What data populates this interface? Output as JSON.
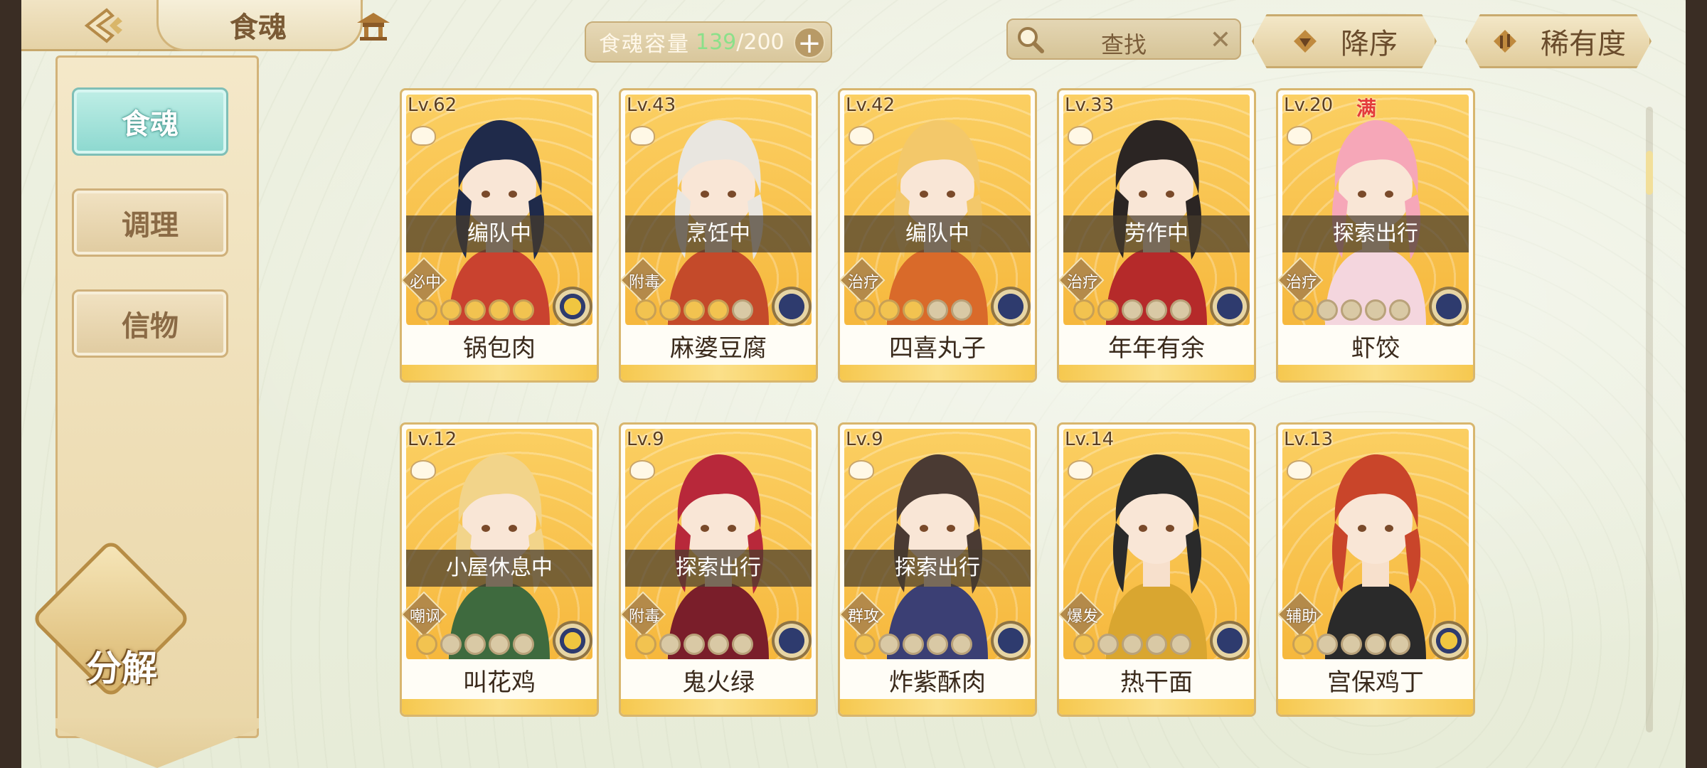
{
  "header": {
    "title": "食魂",
    "capacity_label": "食魂容量",
    "capacity_count": "139",
    "capacity_total": "/200",
    "search_placeholder": "查找",
    "sort_order_label": "降序",
    "sort_rarity_label": "稀有度"
  },
  "sidebar": {
    "tabs": [
      {
        "label": "食魂",
        "active": true
      },
      {
        "label": "调理",
        "active": false
      },
      {
        "label": "信物",
        "active": false
      }
    ],
    "decompose_label": "分解"
  },
  "colors": {
    "accent_teal": "#8cd8cf",
    "card_gold": "#f6b83d",
    "capacity_green": "#8be08a"
  },
  "cards": [
    {
      "level": "Lv.62",
      "status": "编队中",
      "role": "必中",
      "stars": 5,
      "element": "gold",
      "name": "锅包肉",
      "hair": "#1f2a4a",
      "cloth": "#c9422f"
    },
    {
      "level": "Lv.43",
      "status": "烹饪中",
      "role": "附毒",
      "stars": 4,
      "element": "blue",
      "name": "麻婆豆腐",
      "hair": "#e9e6e0",
      "cloth": "#c44a2a"
    },
    {
      "level": "Lv.42",
      "status": "编队中",
      "role": "治疗",
      "stars": 3,
      "element": "blue",
      "name": "四喜丸子",
      "hair": "#f3c86a",
      "cloth": "#d96a2a"
    },
    {
      "level": "Lv.33",
      "status": "劳作中",
      "role": "治疗",
      "stars": 2,
      "element": "blue",
      "name": "年年有余",
      "hair": "#2b2523",
      "cloth": "#b52a2a"
    },
    {
      "level": "Lv.20",
      "status": "探索出行",
      "role": "治疗",
      "stars": 1,
      "element": "blue",
      "name": "虾饺",
      "hair": "#f6a7b8",
      "cloth": "#f4d6de",
      "badge": "满"
    },
    {
      "level": "Lv.12",
      "status": "小屋休息中",
      "role": "嘲讽",
      "stars": 1,
      "element": "gold",
      "name": "叫花鸡",
      "hair": "#f2d48a",
      "cloth": "#3e6a3e"
    },
    {
      "level": "Lv.9",
      "status": "探索出行",
      "role": "附毒",
      "stars": 1,
      "element": "blue",
      "name": "鬼火绿",
      "hair": "#b8283a",
      "cloth": "#7a1e2a"
    },
    {
      "level": "Lv.9",
      "status": "探索出行",
      "role": "群攻",
      "stars": 1,
      "element": "blue",
      "name": "炸紫酥肉",
      "hair": "#4a3a33",
      "cloth": "#3b3f74"
    },
    {
      "level": "Lv.14",
      "status": "",
      "role": "爆发",
      "stars": 1,
      "element": "blue",
      "name": "热干面",
      "hair": "#2a2a2a",
      "cloth": "#d9a630"
    },
    {
      "level": "Lv.13",
      "status": "",
      "role": "辅助",
      "stars": 1,
      "element": "gold",
      "name": "宫保鸡丁",
      "hair": "#c9452a",
      "cloth": "#2a2a2a"
    }
  ]
}
